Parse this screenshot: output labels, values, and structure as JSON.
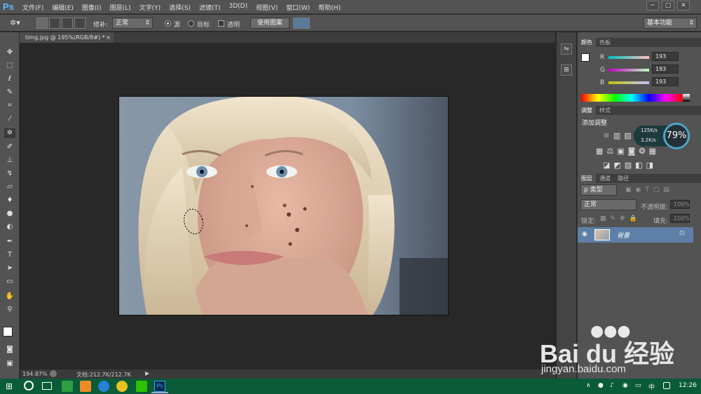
{
  "app": {
    "logo": "Ps"
  },
  "menu": [
    "文件(F)",
    "编辑(E)",
    "图像(I)",
    "图层(L)",
    "文字(Y)",
    "选择(S)",
    "滤镜(T)",
    "3D(D)",
    "视图(V)",
    "窗口(W)",
    "帮助(H)"
  ],
  "window_buttons": [
    "─",
    "▢",
    "✕"
  ],
  "options": {
    "repair_label": "修补:",
    "mode_value": "正常",
    "source_label": "源",
    "target_label": "目标",
    "transparent_label": "透明",
    "use_pattern_label": "使用图案",
    "workspace": "基本功能"
  },
  "document": {
    "tab_title": "timg.jpg @ 195%(RGB/8#) *",
    "close": "×"
  },
  "status": {
    "zoom": "194.87%",
    "doc": "文档:212.7K/212.7K"
  },
  "color_panel": {
    "tabs": [
      "颜色",
      "色板"
    ],
    "channels": [
      {
        "label": "R",
        "value": "193",
        "color": "#d46a6a"
      },
      {
        "label": "G",
        "value": "193",
        "color": "#6ac66a"
      },
      {
        "label": "B",
        "value": "193",
        "color": "#d8d86a"
      }
    ]
  },
  "adjust_panel": {
    "tabs": [
      "调整",
      "样式"
    ],
    "title": "添加调整",
    "net_up": "125K/s",
    "net_down": "3.2K/s",
    "percent": "79%"
  },
  "layers_panel": {
    "tabs": [
      "图层",
      "通道",
      "路径"
    ],
    "filter_label": "ρ 类型",
    "blend_mode": "正常",
    "opacity_label": "不透明度:",
    "opacity_value": "100%",
    "lock_label": "锁定:",
    "fill_label": "填充:",
    "fill_value": "100%",
    "layer_name": "背景"
  },
  "watermark": {
    "brand": "Bai du 经验",
    "url": "jingyan.baidu.com"
  },
  "taskbar": {
    "lang": "中",
    "time": "12:26"
  }
}
